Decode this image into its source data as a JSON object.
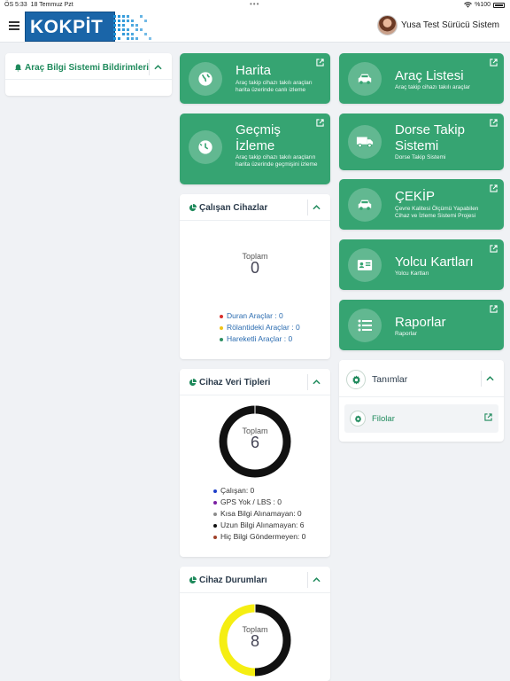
{
  "status_bar": {
    "time": "ÖS 5:33",
    "date": "18 Temmuz Pzt",
    "battery": "%100",
    "dots": "•••"
  },
  "header": {
    "logo_text": "KOKPİT",
    "user_name": "Yusa Test Sürücü Sistem"
  },
  "notifications_panel": {
    "title": "Araç Bilgi Sistemi Bildirimleri"
  },
  "tiles": {
    "harita": {
      "name": "Harita",
      "desc": "Araç takip cihazı takılı araçları harita üzerinde canlı izleme"
    },
    "arac_listesi": {
      "name": "Araç Listesi",
      "desc": "Araç takip cihazı takılı araçlar"
    },
    "gecmis": {
      "name": "Geçmiş İzleme",
      "desc": "Araç takip cihazı takılı araçların harita üzerinde geçmişini izleme"
    },
    "dorse": {
      "name": "Dorse Takip Sistemi",
      "desc": "Dorse Takip Sistemi"
    },
    "cekip": {
      "name": "ÇEKİP",
      "desc": "Çevre Kalitesi Ölçümü Yapabilen Cihaz ve İzleme Sistemi Projesi"
    },
    "yolcu": {
      "name": "Yolcu Kartları",
      "desc": "Yolcu Kartları"
    },
    "raporlar": {
      "name": "Raporlar",
      "desc": "Raporlar"
    }
  },
  "calisan_cihazlar": {
    "title": "Çalışan Cihazlar",
    "total_label": "Toplam",
    "total_value": "0",
    "legend": [
      {
        "label": "Duran Araçlar : 0",
        "color": "#d9302c"
      },
      {
        "label": "Rölantideki Araçlar : 0",
        "color": "#f0c419"
      },
      {
        "label": "Hareketli Araçlar : 0",
        "color": "#2e8f63"
      }
    ]
  },
  "cihaz_veri_tipleri": {
    "title": "Cihaz Veri Tipleri",
    "total_label": "Toplam",
    "total_value": "6",
    "legend": [
      {
        "label": "Çalışan: 0",
        "color": "#1e3fc9"
      },
      {
        "label": "GPS Yok / LBS : 0",
        "color": "#7a1fa2"
      },
      {
        "label": "Kısa Bilgi Alınamayan: 0",
        "color": "#8c8c8c"
      },
      {
        "label": "Uzun Bilgi Alınamayan: 6",
        "color": "#111111"
      },
      {
        "label": "Hiç Bilgi Göndermeyen: 0",
        "color": "#a0422a"
      }
    ]
  },
  "cihaz_durumlari": {
    "title": "Cihaz Durumları",
    "total_label": "Toplam",
    "total_value": "8"
  },
  "tanimlar": {
    "title": "Tanımlar",
    "items": [
      {
        "label": "Filolar"
      }
    ]
  },
  "colors": {
    "tile_green": "#36a472",
    "title_green": "#1f8a5c",
    "ring_black": "#111111",
    "ring_yellow": "#f5ee12"
  },
  "chart_data": [
    {
      "type": "pie",
      "title": "Cihaz Veri Tipleri",
      "categories": [
        "Çalışan",
        "GPS Yok / LBS",
        "Kısa Bilgi Alınamayan",
        "Uzun Bilgi Alınamayan",
        "Hiç Bilgi Göndermeyen"
      ],
      "values": [
        0,
        0,
        0,
        6,
        0
      ],
      "colors": [
        "#1e3fc9",
        "#7a1fa2",
        "#8c8c8c",
        "#111111",
        "#a0422a"
      ],
      "center_label": "Toplam",
      "center_value": 6
    },
    {
      "type": "pie",
      "title": "Cihaz Durumları",
      "categories": [
        "",
        ""
      ],
      "values": [
        4,
        4
      ],
      "colors": [
        "#111111",
        "#f5ee12"
      ],
      "center_label": "Toplam",
      "center_value": 8
    }
  ]
}
